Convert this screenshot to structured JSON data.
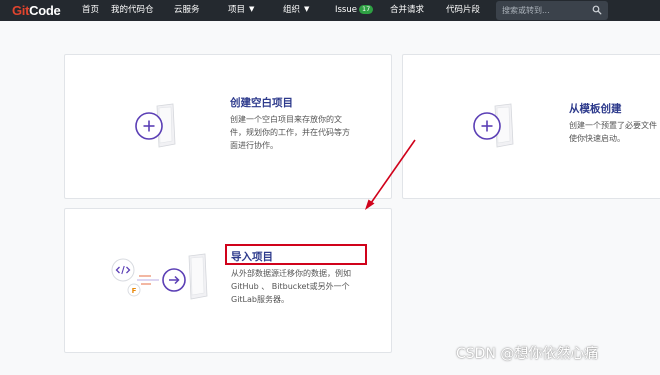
{
  "logo": {
    "part1": "Git",
    "part2": "Code"
  },
  "nav": {
    "home": "首页",
    "my_repos": "我的代码仓",
    "cloud": "云服务",
    "projects": "项目",
    "orgs": "组织",
    "issue": "Issue",
    "issue_count": "17",
    "merge_requests": "合并请求",
    "snippets": "代码片段"
  },
  "search": {
    "placeholder": "搜索或转到..."
  },
  "cards": {
    "blank": {
      "title": "创建空白项目",
      "desc_lines": [
        "创建一个空白项目来存放你的文",
        "件，规划你的工作，并在代码等方",
        "面进行协作。"
      ]
    },
    "template": {
      "title": "从模板创建",
      "desc_lines": [
        "创建一个预置了必要文件",
        "使你快速启动。"
      ]
    },
    "import": {
      "title": "导入项目",
      "desc_lines": [
        "从外部数据源迁移你的数据，例如",
        "GitHub 、 Bitbucket或另外一个",
        "GitLab服务器。"
      ]
    }
  },
  "watermark": "CSDN @想你依然心痛",
  "colors": {
    "accent": "#5b3fb5",
    "highlight_red": "#d0021b",
    "topbar": "#24292f",
    "brand_red": "#e0442e"
  },
  "icons": [
    "plus-icon",
    "code-icon",
    "arrow-right-icon",
    "search-icon",
    "chevron-down-icon"
  ]
}
